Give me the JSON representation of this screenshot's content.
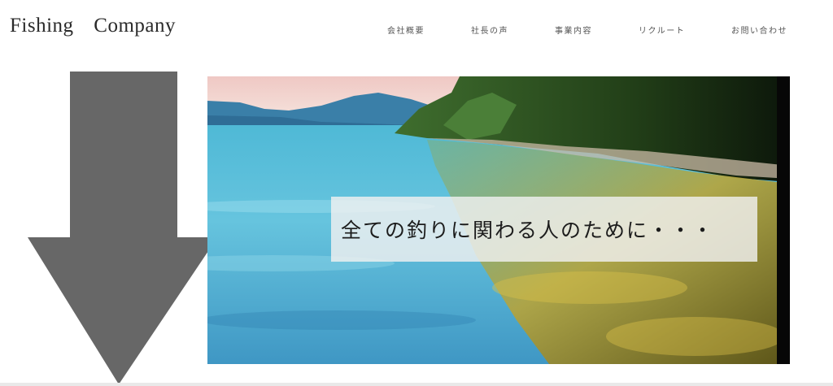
{
  "header": {
    "logo": "Fishing Company"
  },
  "nav": {
    "items": [
      {
        "id": "about",
        "label": "会社概要"
      },
      {
        "id": "president",
        "label": "社長の声"
      },
      {
        "id": "business",
        "label": "事業内容"
      },
      {
        "id": "recruit",
        "label": "リクルート"
      },
      {
        "id": "contact",
        "label": "お問い合わせ"
      }
    ]
  },
  "hero": {
    "tagline": "全ての釣りに関わる人のために・・・"
  },
  "colors": {
    "arrow": "#676767",
    "water_light": "#8ad6e8",
    "water_deep": "#3e93c0",
    "forest": "#274d1c",
    "shallows": "#b3a33a"
  },
  "icons": {
    "arrow": "down-arrow-icon"
  }
}
